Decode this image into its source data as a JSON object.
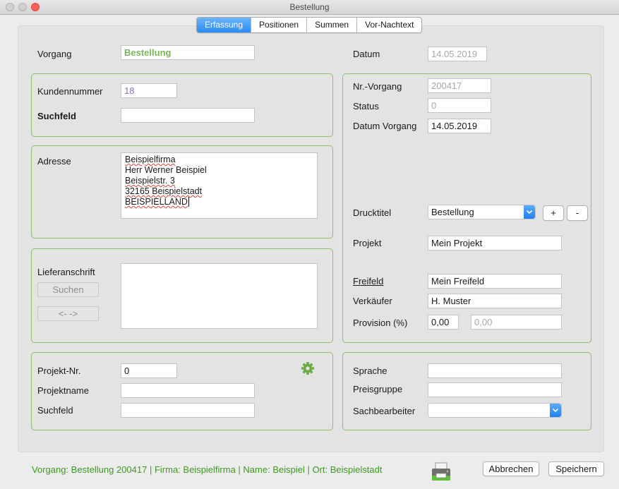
{
  "window": {
    "title": "Bestellung"
  },
  "tabs": [
    "Erfassung",
    "Positionen",
    "Summen",
    "Vor-Nachtext"
  ],
  "header": {
    "vorgang_label": "Vorgang",
    "vorgang_value": "Bestellung",
    "datum_label": "Datum",
    "datum_value": "14.05.2019"
  },
  "kunde": {
    "kundennummer_label": "Kundennummer",
    "kundennummer_value": "18",
    "suchfeld_label": "Suchfeld",
    "suchfeld_value": ""
  },
  "adresse": {
    "label": "Adresse",
    "lines": [
      "Beispielfirma",
      "Herr Werner Beispiel",
      "Beispielstr. 3",
      "32165 Beispielstadt",
      "BEISPIELLAND"
    ]
  },
  "lieferanschrift": {
    "label": "Lieferanschrift",
    "suchen_button": "Suchen",
    "swap_button": "<- ->"
  },
  "projekt": {
    "nr_label": "Projekt-Nr.",
    "nr_value": "0",
    "name_label": "Projektname",
    "name_value": "",
    "suchfeld_label": "Suchfeld",
    "suchfeld_value": ""
  },
  "details": {
    "nr_vorgang_label": "Nr.-Vorgang",
    "nr_vorgang_value": "200417",
    "status_label": "Status",
    "status_value": "0",
    "datum_vorgang_label": "Datum Vorgang",
    "datum_vorgang_value": "14.05.2019",
    "drucktitel_label": "Drucktitel",
    "drucktitel_value": "Bestellung",
    "plus_button": "+",
    "minus_button": "-",
    "projekt_label": "Projekt",
    "projekt_value": "Mein Projekt",
    "freifeld_label": "Freifeld",
    "freifeld_value": "Mein Freifeld",
    "verkaeufer_label": "Verkäufer",
    "verkaeufer_value": "H. Muster",
    "provision_label": "Provision (%)",
    "provision_value": "0,00",
    "provision_amount": "0,00"
  },
  "sprache": {
    "sprache_label": "Sprache",
    "sprache_value": "",
    "preisgruppe_label": "Preisgruppe",
    "preisgruppe_value": "",
    "sachbearbeiter_label": "Sachbearbeiter",
    "sachbearbeiter_value": ""
  },
  "footer": {
    "status_text": "Vorgang: Bestellung 200417 | Firma: Beispielfirma | Name: Beispiel | Ort: Beispielstadt",
    "abbrechen_button": "Abbrechen",
    "speichern_button": "Speichern"
  },
  "colors": {
    "accent": "#2a8cf6",
    "group_border": "#8fbe6e",
    "status_text": "#3d9b20"
  }
}
